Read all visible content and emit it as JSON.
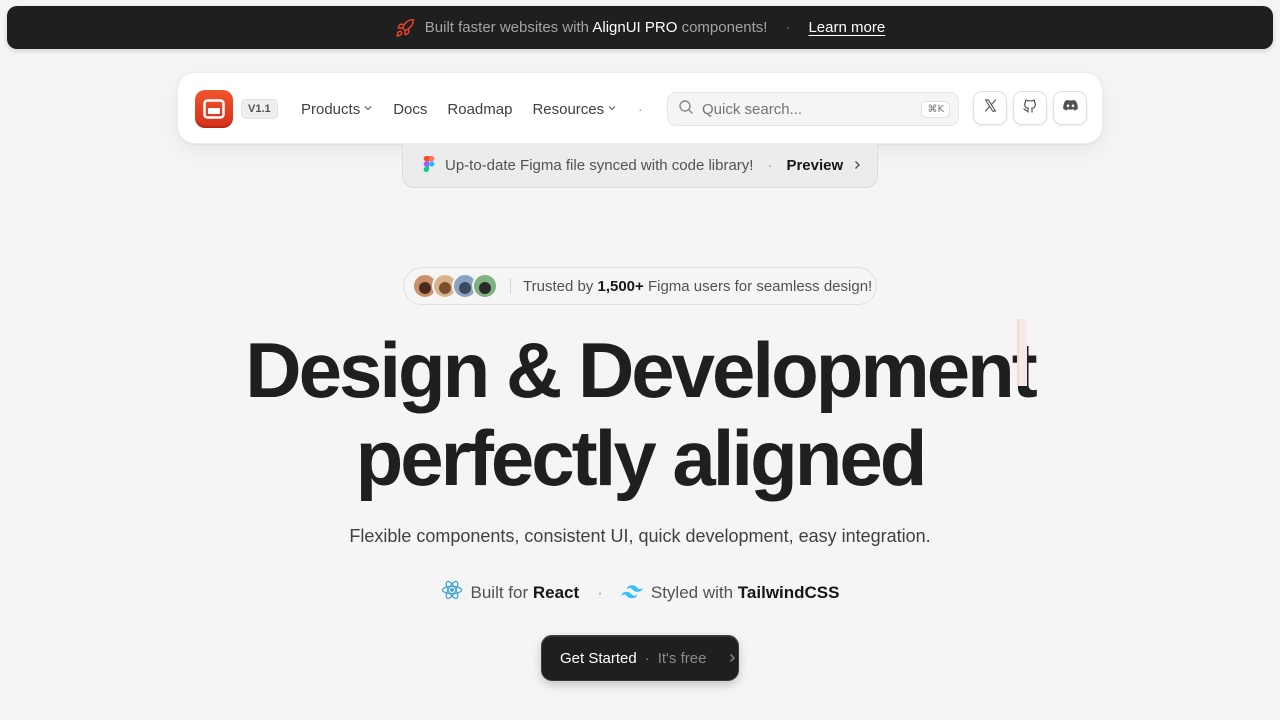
{
  "banner": {
    "text_prefix": "Built faster websites with",
    "text_strong": "AlignUI PRO",
    "text_suffix": "components!",
    "separator": "·",
    "link": "Learn more",
    "icon": "rocket-icon"
  },
  "navbar": {
    "version": "V1.1",
    "links": [
      {
        "label": "Products",
        "dropdown": true
      },
      {
        "label": "Docs",
        "dropdown": false
      },
      {
        "label": "Roadmap",
        "dropdown": false
      },
      {
        "label": "Resources",
        "dropdown": true
      }
    ],
    "dot": "·",
    "search": {
      "placeholder": "Quick search...",
      "shortcut": "⌘K"
    },
    "social": [
      "x-icon",
      "github-icon",
      "discord-icon"
    ]
  },
  "figma_bar": {
    "text": "Up-to-date Figma file synced with code library!",
    "separator": "·",
    "cta": "Preview"
  },
  "trusted": {
    "prefix": "Trusted by",
    "count": "1,500+",
    "suffix": "Figma users for seamless design!"
  },
  "hero": {
    "line1": "Design & Development",
    "line2": "perfectly aligned",
    "subtitle": "Flexible components, consistent UI, quick development, easy integration."
  },
  "built": {
    "react_prefix": "Built for",
    "react_name": "React",
    "separator": "·",
    "tw_prefix": "Styled with",
    "tw_name": "TailwindCSS"
  },
  "cta": {
    "label": "Get Started",
    "separator": "·",
    "sub": "It's free"
  },
  "colors": {
    "accent": "#e0401f",
    "banner_bg": "#1f1f1f",
    "react": "#3ba1d8",
    "tailwind": "#38bdf8"
  }
}
